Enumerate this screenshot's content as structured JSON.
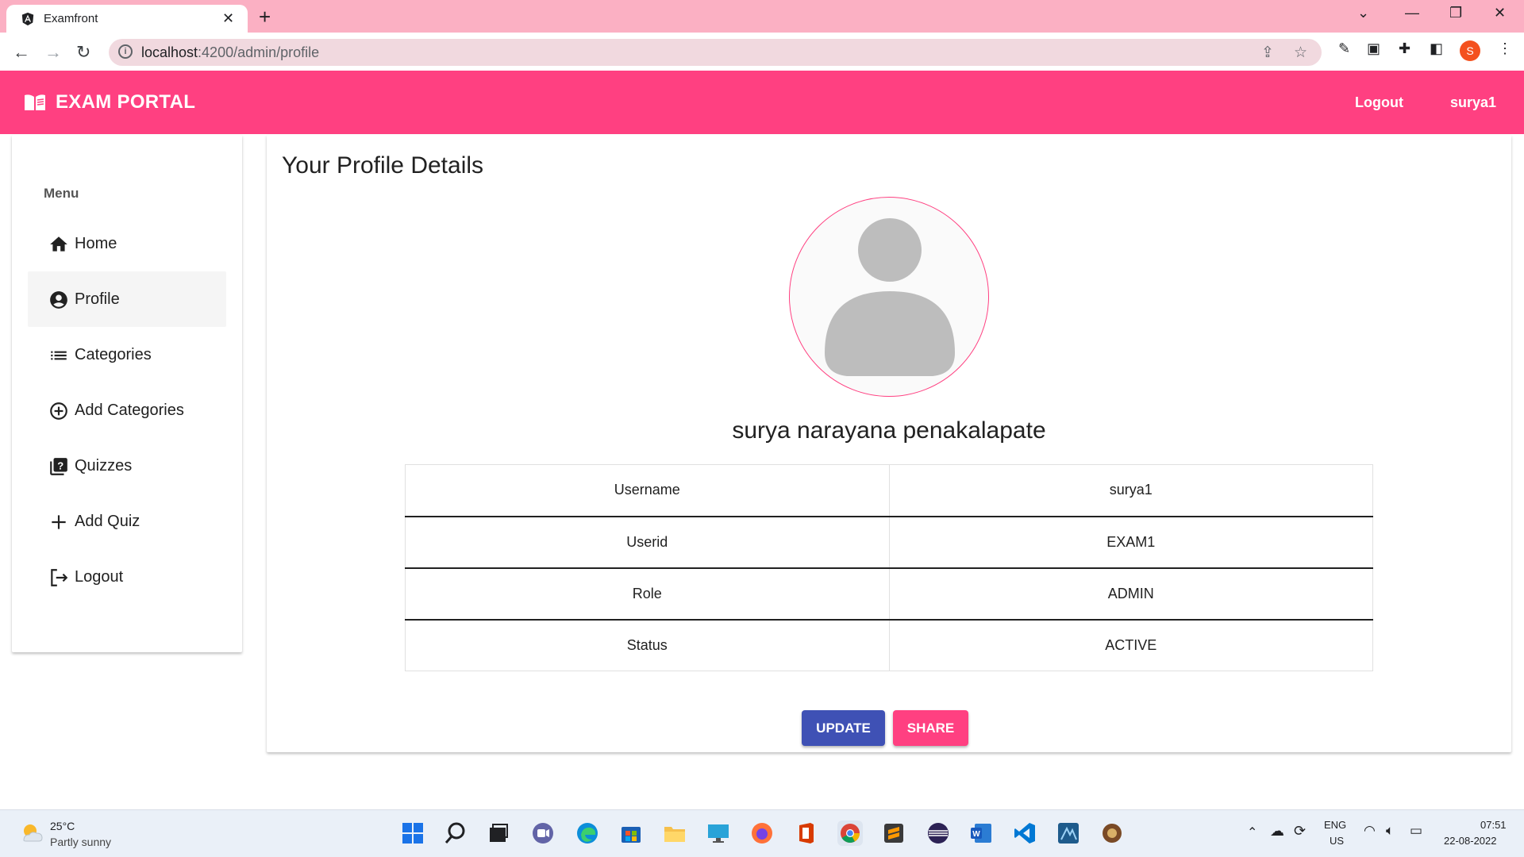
{
  "browser": {
    "tab_title": "Examfront",
    "tab_close": "✕",
    "new_tab": "+",
    "url_host": "localhost",
    "url_path": ":4200/admin/profile",
    "profile_initial": "S"
  },
  "navbar": {
    "brand": "EXAM PORTAL",
    "logout": "Logout",
    "username": "surya1"
  },
  "sidebar": {
    "title": "Menu",
    "items": [
      {
        "label": "Home",
        "icon": "home-icon",
        "active": false
      },
      {
        "label": "Profile",
        "icon": "account-circle-icon",
        "active": true
      },
      {
        "label": "Categories",
        "icon": "list-icon",
        "active": false
      },
      {
        "label": "Add Categories",
        "icon": "add-circle-icon",
        "active": false
      },
      {
        "label": "Quizzes",
        "icon": "quiz-icon",
        "active": false
      },
      {
        "label": "Add Quiz",
        "icon": "plus-icon",
        "active": false
      },
      {
        "label": "Logout",
        "icon": "logout-icon",
        "active": false
      }
    ]
  },
  "profile": {
    "title": "Your Profile Details",
    "full_name": "surya narayana penakalapate",
    "rows": [
      {
        "label": "Username",
        "value": "surya1"
      },
      {
        "label": "Userid",
        "value": "EXAM1"
      },
      {
        "label": "Role",
        "value": "ADMIN"
      },
      {
        "label": "Status",
        "value": "ACTIVE"
      }
    ],
    "update_label": "UPDATE",
    "share_label": "SHARE"
  },
  "taskbar": {
    "temperature": "25°C",
    "weather": "Partly sunny",
    "language": "ENG",
    "region": "US",
    "time": "07:51",
    "date": "22-08-2022"
  },
  "colors": {
    "primary": "#ff4081",
    "accent": "#3f51b5",
    "tabstrip": "#fbb0c3"
  }
}
